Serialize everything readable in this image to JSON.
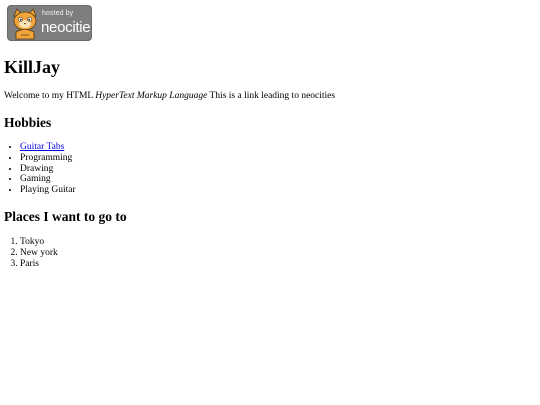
{
  "badge": {
    "hosted_text": "hosted by",
    "brand_text": "neocities",
    "icon": "neocities-cat-logo-icon"
  },
  "page": {
    "title": "KillJay",
    "intro_prefix": "Welcome to my HTML ",
    "intro_emphasis": "HyperText Markup Language",
    "intro_suffix": " This is a link leading to neocities"
  },
  "hobbies": {
    "heading": "Hobbies",
    "items": [
      "Guitar Tabs",
      "Programming",
      "Drawing",
      "Gaming",
      "Playing Guitar"
    ]
  },
  "places": {
    "heading": "Places I want to go to",
    "items": [
      "Tokyo",
      "New york",
      "Paris"
    ]
  },
  "colors": {
    "link": "#0000ee",
    "badge_bg": "#7e7e7e",
    "cat_orange": "#f0a43a"
  }
}
